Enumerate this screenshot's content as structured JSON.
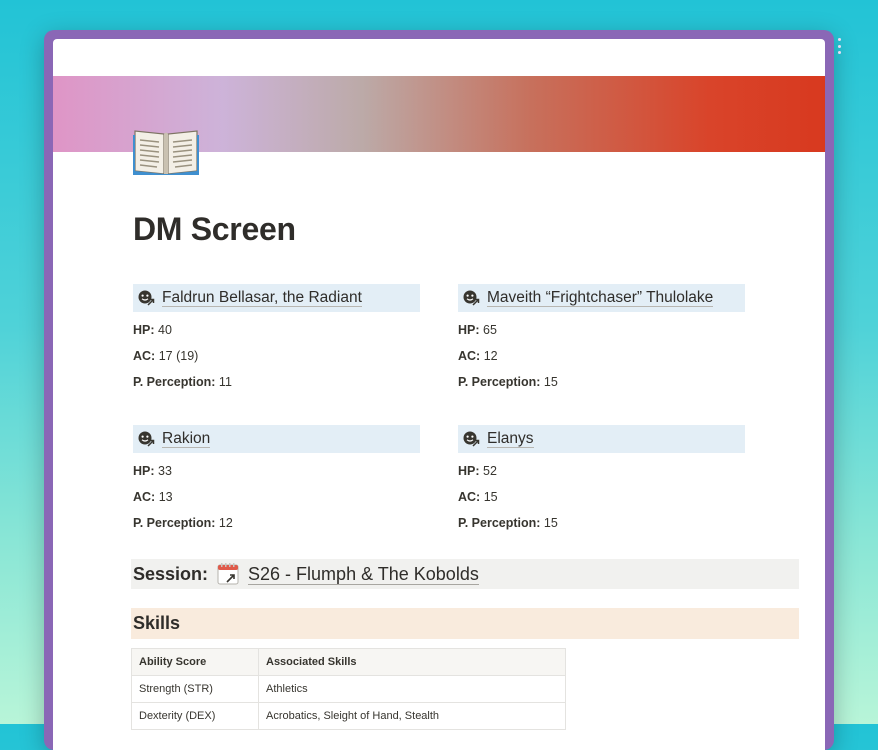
{
  "page": {
    "icon": "open-book-icon",
    "title": "DM Screen",
    "cover_colors": [
      "#df95c6",
      "#cdb3d9",
      "#bcaaa8",
      "#c7705c",
      "#d8391f"
    ]
  },
  "characters": [
    {
      "icon": "face-arrow-icon",
      "name": "Faldrun Bellasar, the Radiant",
      "hp_label": "HP:",
      "hp": "40",
      "ac_label": "AC:",
      "ac": "17 (19)",
      "pp_label": "P. Perception:",
      "pp": "11"
    },
    {
      "icon": "face-arrow-icon",
      "name": "Maveith “Frightchaser” Thulolake",
      "hp_label": "HP:",
      "hp": "65",
      "ac_label": "AC:",
      "ac": "12",
      "pp_label": "P. Perception:",
      "pp": "15"
    },
    {
      "icon": "face-arrow-icon",
      "name": "Rakion",
      "hp_label": "HP:",
      "hp": "33",
      "ac_label": "AC:",
      "ac": "13",
      "pp_label": "P. Perception:",
      "pp": "12"
    },
    {
      "icon": "face-arrow-icon",
      "name": "Elanys",
      "hp_label": "HP:",
      "hp": "52",
      "ac_label": "AC:",
      "ac": "15",
      "pp_label": "P. Perception:",
      "pp": "15"
    }
  ],
  "session": {
    "label": "Session:",
    "icon": "calendar-link-icon",
    "link": "S26 - Flumph & The Kobolds"
  },
  "skills": {
    "heading": "Skills",
    "columns": [
      "Ability Score",
      "Associated Skills"
    ],
    "rows": [
      [
        "Strength (STR)",
        "Athletics"
      ],
      [
        "Dexterity (DEX)",
        "Acrobatics, Sleight of Hand, Stealth"
      ]
    ]
  }
}
